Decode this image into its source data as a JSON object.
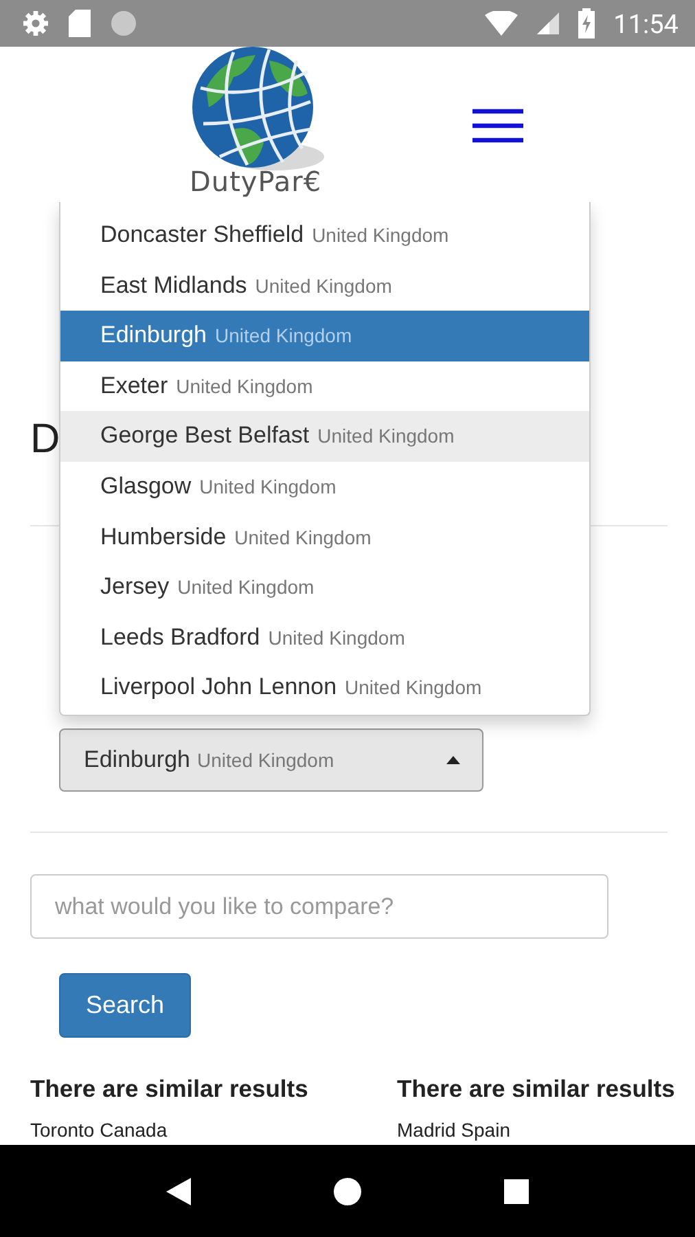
{
  "status_bar": {
    "time": "11:54"
  },
  "header": {
    "logo_text": "DutyPar€"
  },
  "page": {
    "heading": "D"
  },
  "airport_select": {
    "city": "Edinburgh",
    "country": "United Kingdom",
    "open": true
  },
  "dropdown": {
    "items": [
      {
        "city": "Doncaster Sheffield",
        "country": "United Kingdom",
        "selected": false,
        "hovered": false
      },
      {
        "city": "East Midlands",
        "country": "United Kingdom",
        "selected": false,
        "hovered": false
      },
      {
        "city": "Edinburgh",
        "country": "United Kingdom",
        "selected": true,
        "hovered": false
      },
      {
        "city": "Exeter",
        "country": "United Kingdom",
        "selected": false,
        "hovered": false
      },
      {
        "city": "George Best Belfast",
        "country": "United Kingdom",
        "selected": false,
        "hovered": true
      },
      {
        "city": "Glasgow",
        "country": "United Kingdom",
        "selected": false,
        "hovered": false
      },
      {
        "city": "Humberside",
        "country": "United Kingdom",
        "selected": false,
        "hovered": false
      },
      {
        "city": "Jersey",
        "country": "United Kingdom",
        "selected": false,
        "hovered": false
      },
      {
        "city": "Leeds Bradford",
        "country": "United Kingdom",
        "selected": false,
        "hovered": false
      },
      {
        "city": "Liverpool John Lennon",
        "country": "United Kingdom",
        "selected": false,
        "hovered": false
      }
    ]
  },
  "search": {
    "placeholder": "what would you like to compare?",
    "button": "Search"
  },
  "results": [
    {
      "heading": "There are similar results",
      "item": "Toronto Canada"
    },
    {
      "heading": "There are similar results",
      "item": "Madrid Spain"
    }
  ]
}
